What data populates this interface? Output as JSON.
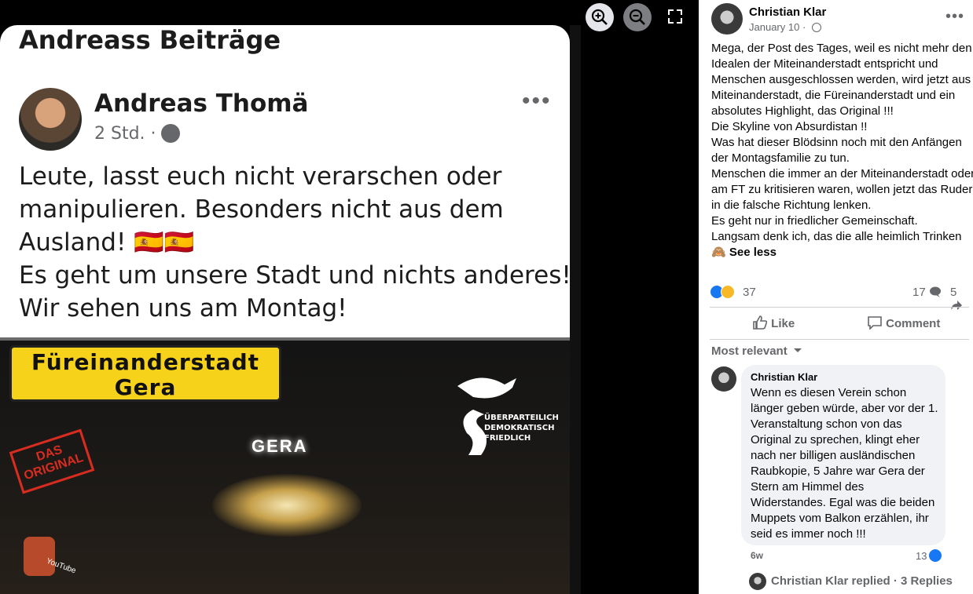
{
  "screenshot": {
    "header": "Andreass Beiträge",
    "author": "Andreas Thomä",
    "time": "2 Std.",
    "dot": "·",
    "more": "•••",
    "body_lines": [
      "Leute, lasst euch nicht verarschen oder",
      "manipulieren. Besonders nicht aus dem",
      "Ausland! 🇪🇸🇪🇸",
      "Es geht um unsere Stadt und nichts anderes!",
      "Wir sehen uns am Montag!"
    ],
    "image": {
      "sign_line1": "Füreinanderstadt",
      "sign_line2": "Gera",
      "stamp_line1": "DAS",
      "stamp_line2": "ORIGINAL",
      "city_label": "GERA",
      "party_line1": "ÜBERPARTEILICH",
      "party_line2": "DEMOKRATISCH",
      "party_line3": "FRIEDLICH",
      "youtube": "YouTube"
    }
  },
  "post": {
    "author": "Christian Klar",
    "date": "January 10",
    "date_sep": "·",
    "more": "•••",
    "text_lines": [
      "Mega, der Post des Tages, weil es nicht mehr den",
      "Idealen der Miteinanderstadt entspricht und",
      "Menschen ausgeschlossen werden, wird jetzt aus",
      "Miteinanderstadt, die Füreinanderstadt und ein",
      "absolutes Highlight, das Original !!!",
      "Die Skyline von Absurdistan !!",
      "Was hat dieser Blödsinn noch mit den Anfängen",
      "der Montagsfamilie zu tun.",
      "Menschen die immer an der Miteinanderstadt oder",
      "am FT zu kritisieren waren, wollen jetzt das Ruder",
      "in die falsche Richtung lenken.",
      "Es geht nur in friedlicher Gemeinschaft.",
      "Langsam denk ich, das die alle heimlich Trinken"
    ],
    "see_less_emoji": "🙈",
    "see_less": "See less",
    "reaction_count": "37",
    "comment_count": "17",
    "share_count": "5",
    "like_label": "Like",
    "comment_label": "Comment",
    "sort_label": "Most relevant"
  },
  "comment": {
    "author": "Christian Klar",
    "text_lines": [
      "Wenn es diesen Verein schon",
      "länger geben würde, aber vor der 1.",
      "Veranstaltung schon von das",
      "Original zu sprechen, klingt eher",
      "nach ner billigen ausländischen",
      "Raubkopie, 5 Jahre war Gera der",
      "Stern am Himmel des",
      "Widerstandes. Egal was die beiden",
      "Muppets vom Balkon erzählen, ihr",
      "seid es immer noch !!!"
    ],
    "time": "6w",
    "likes": "13",
    "reply_summary": "Christian Klar replied · 3 Replies"
  },
  "icons": {
    "zoom_in": "zoom-in-icon",
    "zoom_out": "zoom-out-icon",
    "fullscreen": "expand-icon",
    "globe": "globe-icon",
    "like": "thumbs-up-icon",
    "comment": "comment-bubble-icon",
    "share": "share-arrow-icon",
    "chevron": "chevron-down-icon"
  },
  "colors": {
    "accent": "#1877f2",
    "secondary_text": "#65676b",
    "bubble": "#f0f2f5",
    "sign_yellow": "#f6d21a"
  }
}
